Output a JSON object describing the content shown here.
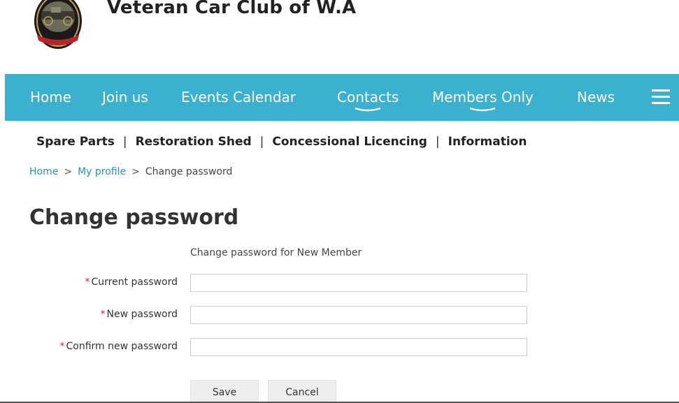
{
  "site": {
    "title": "Veteran Car Club of W.A",
    "logo_icon": "veteran-car-club-logo",
    "logo_colors": {
      "outer": "#1a1a1a",
      "ring": "#c8a24a",
      "banner": "#b8262b"
    }
  },
  "colors": {
    "accent": "#3cb0cf",
    "link": "#2a8fb6",
    "required": "#d9232d"
  },
  "nav": {
    "items": [
      {
        "label": "Home"
      },
      {
        "label": "Join us"
      },
      {
        "label": "Events Calendar"
      },
      {
        "label": "Contacts",
        "has_dropdown": true
      },
      {
        "label": "Members Only",
        "has_dropdown": true
      },
      {
        "label": "News"
      }
    ],
    "menu_icon": "hamburger-menu-icon"
  },
  "subnav": {
    "items": [
      {
        "label": "Spare Parts"
      },
      {
        "label": "Restoration Shed"
      },
      {
        "label": "Concessional Licencing"
      },
      {
        "label": "Information"
      }
    ],
    "separator": "|"
  },
  "breadcrumb": {
    "items": [
      {
        "label": "Home"
      },
      {
        "label": "My profile"
      },
      {
        "label": "Change password"
      }
    ],
    "separator": ">"
  },
  "page": {
    "title": "Change password",
    "intro": "Change password for New Member"
  },
  "form": {
    "required_marker": "*",
    "fields": [
      {
        "label": "Current password",
        "value": ""
      },
      {
        "label": "New password",
        "value": ""
      },
      {
        "label": "Confirm new password",
        "value": ""
      }
    ],
    "save_label": "Save",
    "cancel_label": "Cancel"
  }
}
